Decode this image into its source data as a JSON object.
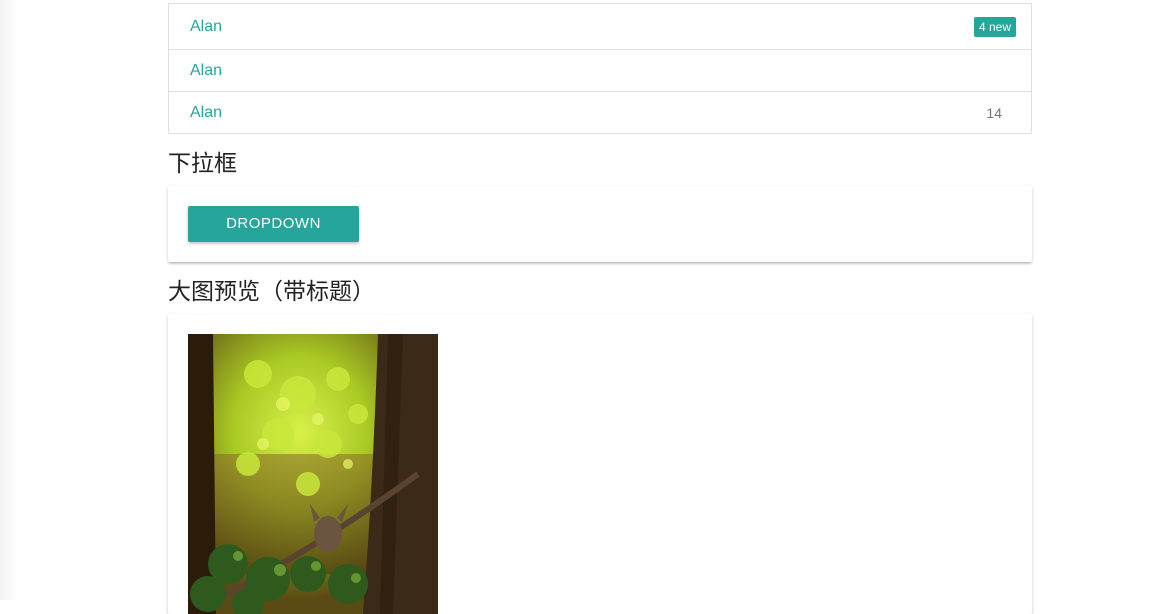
{
  "list": {
    "items": [
      {
        "name": "Alan",
        "badge": "4 new",
        "badge_type": "new"
      },
      {
        "name": "Alan",
        "badge": "",
        "badge_type": "none"
      },
      {
        "name": "Alan",
        "badge": "14",
        "badge_type": "plain"
      }
    ]
  },
  "dropdown_section": {
    "title": "下拉框",
    "button_label": "DROPDOWN"
  },
  "image_section": {
    "title": "大图预览（带标题）",
    "image": "forest-deer-photo"
  },
  "colors": {
    "accent": "#26a69a",
    "badge_text": "#757575"
  }
}
